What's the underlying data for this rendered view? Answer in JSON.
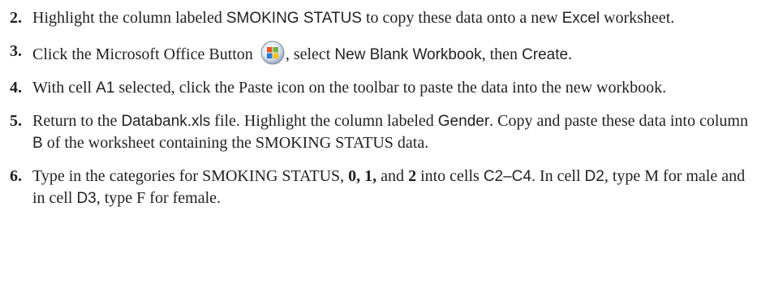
{
  "steps": [
    {
      "number": "2.",
      "parts": {
        "a": "Highlight the column labeled ",
        "b": "SMOKING STATUS",
        "c": " to copy these data onto a new ",
        "d": "Excel",
        "e": " worksheet."
      }
    },
    {
      "number": "3.",
      "icon": "microsoft-office-button-icon",
      "parts": {
        "a": "Click the Microsoft Office Button ",
        "b": ", select ",
        "c": "New Blank Workbook",
        "d": ", then ",
        "e": "Create",
        "f": "."
      }
    },
    {
      "number": "4.",
      "parts": {
        "a": "With cell ",
        "b": "A1",
        "c": " selected, click the Paste icon on the toolbar to paste the data into the new workbook."
      }
    },
    {
      "number": "5.",
      "parts": {
        "a": "Return to the ",
        "b": "Databank.xls",
        "c": " file. Highlight the column labeled ",
        "d": "Gender",
        "e": ". Copy and paste these data into column ",
        "f": "B",
        "g": " of the worksheet containing the SMOKING STATUS data."
      }
    },
    {
      "number": "6.",
      "parts": {
        "a": "Type in the categories for SMOKING STATUS, ",
        "b": "0, 1,",
        "c": " and ",
        "d": "2",
        "e": " into cells ",
        "f": "C2–C4",
        "g": ". In cell ",
        "h": "D2",
        "i": ", type M for male and in cell ",
        "j": "D3",
        "k": ", type F for female."
      }
    }
  ]
}
